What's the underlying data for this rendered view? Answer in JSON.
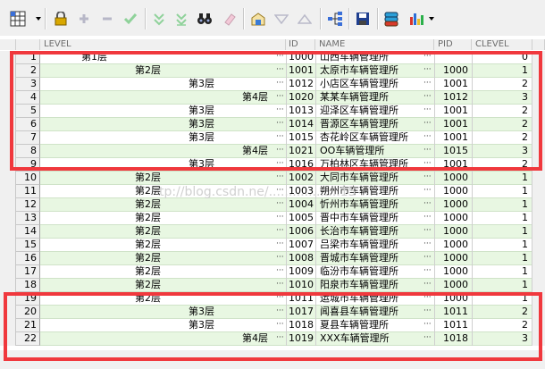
{
  "toolbar": {
    "buttons": [
      "grid-menu",
      "lock",
      "add",
      "remove",
      "confirm",
      "expand-all",
      "collapse-all",
      "find",
      "eraser",
      "import",
      "filter",
      "sort-up",
      "tree-structure",
      "save",
      "database",
      "chart"
    ]
  },
  "columns": {
    "level": "LEVEL",
    "id": "ID",
    "name": "NAME",
    "pid": "PID",
    "clevel": "CLEVEL"
  },
  "ellipsis": "···",
  "watermark": "tp://blog.csdn.ne/..................15",
  "highlight_color": "#f0383d",
  "rows": [
    {
      "num": "1",
      "level": "第1层",
      "depth": 1,
      "id": "1000",
      "name": "山西车辆管理所",
      "pid": "",
      "clevel": "0"
    },
    {
      "num": "2",
      "level": "第2层",
      "depth": 2,
      "id": "1001",
      "name": "太原市车辆管理所",
      "pid": "1000",
      "clevel": "1"
    },
    {
      "num": "3",
      "level": "第3层",
      "depth": 3,
      "id": "1012",
      "name": "小店区车辆管理所",
      "pid": "1001",
      "clevel": "2"
    },
    {
      "num": "4",
      "level": "第4层",
      "depth": 4,
      "id": "1020",
      "name": "某某车辆管理所",
      "pid": "1012",
      "clevel": "3"
    },
    {
      "num": "5",
      "level": "第3层",
      "depth": 3,
      "id": "1013",
      "name": "迎泽区车辆管理所",
      "pid": "1001",
      "clevel": "2"
    },
    {
      "num": "6",
      "level": "第3层",
      "depth": 3,
      "id": "1014",
      "name": "晋源区车辆管理所",
      "pid": "1001",
      "clevel": "2"
    },
    {
      "num": "7",
      "level": "第3层",
      "depth": 3,
      "id": "1015",
      "name": "杏花岭区车辆管理所",
      "pid": "1001",
      "clevel": "2"
    },
    {
      "num": "8",
      "level": "第4层",
      "depth": 4,
      "id": "1021",
      "name": "OO车辆管理所",
      "pid": "1015",
      "clevel": "3"
    },
    {
      "num": "9",
      "level": "第3层",
      "depth": 3,
      "id": "1016",
      "name": "万柏林区车辆管理所",
      "pid": "1001",
      "clevel": "2"
    },
    {
      "num": "10",
      "level": "第2层",
      "depth": 2,
      "id": "1002",
      "name": "大同市车辆管理所",
      "pid": "1000",
      "clevel": "1"
    },
    {
      "num": "11",
      "level": "第2层",
      "depth": 2,
      "id": "1003",
      "name": "朔州市车辆管理所",
      "pid": "1000",
      "clevel": "1"
    },
    {
      "num": "12",
      "level": "第2层",
      "depth": 2,
      "id": "1004",
      "name": "忻州市车辆管理所",
      "pid": "1000",
      "clevel": "1"
    },
    {
      "num": "13",
      "level": "第2层",
      "depth": 2,
      "id": "1005",
      "name": "晋中市车辆管理所",
      "pid": "1000",
      "clevel": "1"
    },
    {
      "num": "14",
      "level": "第2层",
      "depth": 2,
      "id": "1006",
      "name": "长治市车辆管理所",
      "pid": "1000",
      "clevel": "1"
    },
    {
      "num": "15",
      "level": "第2层",
      "depth": 2,
      "id": "1007",
      "name": "吕梁市车辆管理所",
      "pid": "1000",
      "clevel": "1"
    },
    {
      "num": "16",
      "level": "第2层",
      "depth": 2,
      "id": "1008",
      "name": "晋城市车辆管理所",
      "pid": "1000",
      "clevel": "1"
    },
    {
      "num": "17",
      "level": "第2层",
      "depth": 2,
      "id": "1009",
      "name": "临汾市车辆管理所",
      "pid": "1000",
      "clevel": "1"
    },
    {
      "num": "18",
      "level": "第2层",
      "depth": 2,
      "id": "1010",
      "name": "阳泉市车辆管理所",
      "pid": "1000",
      "clevel": "1"
    },
    {
      "num": "19",
      "level": "第2层",
      "depth": 2,
      "id": "1011",
      "name": "运城市车辆管理所",
      "pid": "1000",
      "clevel": "1"
    },
    {
      "num": "20",
      "level": "第3层",
      "depth": 3,
      "id": "1017",
      "name": "闻喜县车辆管理所",
      "pid": "1011",
      "clevel": "2"
    },
    {
      "num": "21",
      "level": "第3层",
      "depth": 3,
      "id": "1018",
      "name": "夏县车辆管理所",
      "pid": "1011",
      "clevel": "2"
    },
    {
      "num": "22",
      "level": "第4层",
      "depth": 4,
      "id": "1019",
      "name": "XXX车辆管理所",
      "pid": "1018",
      "clevel": "3"
    }
  ]
}
